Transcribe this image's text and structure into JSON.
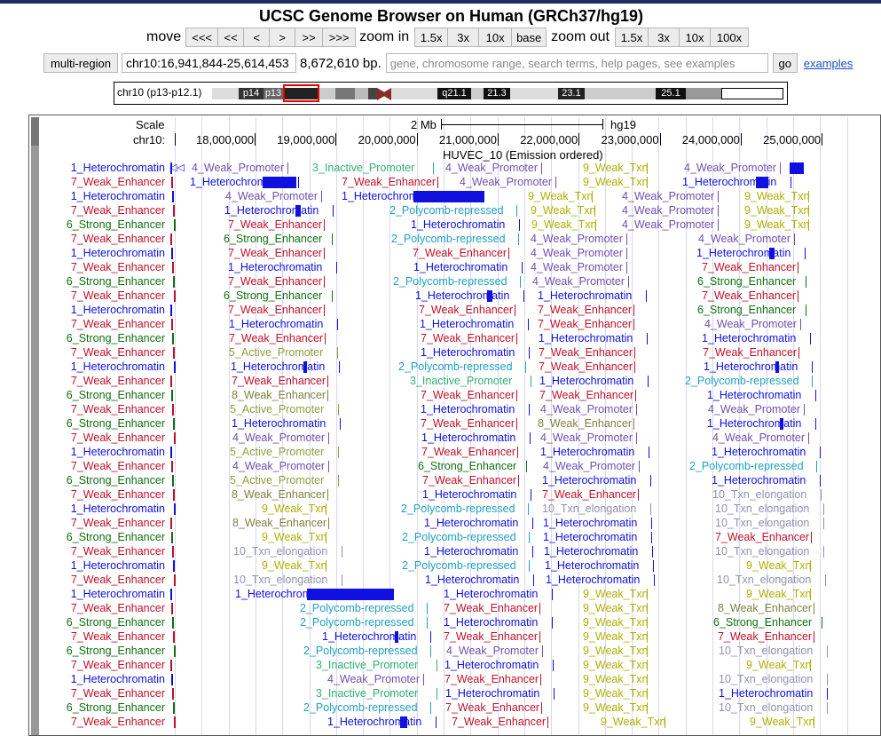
{
  "header": {
    "title": "UCSC Genome Browser on Human (GRCh37/hg19)"
  },
  "nav": {
    "move_label": "move",
    "move_buttons": [
      "<<<",
      "<<",
      "<",
      ">",
      ">>",
      ">>>"
    ],
    "zoom_in_label": "zoom in",
    "zoom_in_buttons": [
      "1.5x",
      "3x",
      "10x",
      "base"
    ],
    "zoom_out_label": "zoom out",
    "zoom_out_buttons": [
      "1.5x",
      "3x",
      "10x",
      "100x"
    ]
  },
  "position": {
    "multi_region": "multi-region",
    "range": "chr10:16,941,844-25,614,453",
    "size": "8,672,610 bp.",
    "search_placeholder": "gene, chromosome range, search terms, help pages, see examples",
    "go": "go",
    "examples": "examples"
  },
  "ideogram": {
    "chrom_label": "chr10 (p13-p12.1)",
    "bands": [
      "p14",
      "p13",
      "q21.1",
      "21.3",
      "23.1",
      "25.1"
    ]
  },
  "tracks": {
    "scale_label": "Scale",
    "scale_bar": "2 Mb",
    "assembly": "hg19",
    "chrom_label": "chr10:",
    "ticks": [
      "18,000,000",
      "19,000,000",
      "20,000,000",
      "21,000,000",
      "22,000,000",
      "23,000,000",
      "24,000,000",
      "25,000,000"
    ],
    "track_title": "HUVEC_10 (Emission ordered)"
  },
  "colors": {
    "Heterochromatin": "#1010e0",
    "Weak_Enhancer": "#c0102a",
    "Strong_Enhancer": "#107010",
    "Weak_Promoter": "#7050b0",
    "Inactive_Promoter": "#30b070",
    "Weak_Txn": "#b0b000",
    "Polycomb": "#20a0c0",
    "Active_Promoter": "#90a040",
    "Txn_elongation": "#9090b0",
    "Weak_Enhancer8": "#808040"
  },
  "rows": [
    {
      "left": "1_Heterochromatin",
      "items": [
        [
          "4_Weak_Promoter",
          215
        ],
        [
          "3_Inactive_Promoter",
          351
        ],
        [
          "4_Weak_Promoter",
          501
        ],
        [
          "9_Weak_Txn",
          656
        ],
        [
          "4_Weak_Promoter",
          770
        ]
      ]
    },
    {
      "left": "7_Weak_Enhancer",
      "items": [
        [
          "1_Heterochromatin",
          213
        ],
        [
          "7_Weak_Enhancer",
          384
        ],
        [
          "4_Weak_Promoter",
          517
        ],
        [
          "9_Weak_Txn",
          656
        ],
        [
          "1_Heterochromatin",
          768
        ]
      ]
    },
    {
      "left": "1_Heterochromatin",
      "items": [
        [
          "4_Weak_Promoter",
          253
        ],
        [
          "1_Heterochromatin",
          384
        ],
        [
          "9_Weak_Txn",
          594
        ],
        [
          "4_Weak_Promoter",
          700
        ],
        [
          "9_Weak_Txn",
          838
        ]
      ]
    },
    {
      "left": "7_Weak_Enhancer",
      "items": [
        [
          "1_Heterochromatin",
          252
        ],
        [
          "2_Polycomb-repressed",
          438
        ],
        [
          "9_Weak_Txn",
          597
        ],
        [
          "4_Weak_Promoter",
          700
        ],
        [
          "9_Weak_Txn",
          838
        ]
      ]
    },
    {
      "left": "6_Strong_Enhancer",
      "items": [
        [
          "7_Weak_Enhancer",
          256
        ],
        [
          "1_Heterochromatin",
          462
        ],
        [
          "9_Weak_Txn",
          598
        ],
        [
          "4_Weak_Promoter",
          700
        ],
        [
          "9_Weak_Txn",
          838
        ]
      ]
    },
    {
      "left": "7_Weak_Enhancer",
      "items": [
        [
          "6_Strong_Enhancer",
          251
        ],
        [
          "2_Polycomb-repressed",
          440
        ],
        [
          "4_Weak_Promoter",
          597
        ],
        [
          "4_Weak_Promoter",
          786
        ]
      ]
    },
    {
      "left": "1_Heterochromatin",
      "items": [
        [
          "7_Weak_Enhancer",
          256
        ],
        [
          "7_Weak_Enhancer",
          464
        ],
        [
          "4_Weak_Promoter",
          597
        ],
        [
          "1_Heterochromatin",
          784
        ]
      ]
    },
    {
      "left": "7_Weak_Enhancer",
      "items": [
        [
          "1_Heterochromatin",
          256
        ],
        [
          "1_Heterochromatin",
          465
        ],
        [
          "4_Weak_Promoter",
          597
        ],
        [
          "7_Weak_Enhancer",
          790
        ]
      ]
    },
    {
      "left": "6_Strong_Enhancer",
      "items": [
        [
          "7_Weak_Enhancer",
          256
        ],
        [
          "2_Polycomb-repressed",
          442
        ],
        [
          "4_Weak_Promoter",
          599
        ],
        [
          "6_Strong_Enhancer",
          785
        ]
      ]
    },
    {
      "left": "7_Weak_Enhancer",
      "items": [
        [
          "6_Strong_Enhancer",
          251
        ],
        [
          "1_Heterochromatin",
          467
        ],
        [
          "1_Heterochromatin",
          605
        ],
        [
          "7_Weak_Enhancer",
          790
        ]
      ]
    },
    {
      "left": "1_Heterochromatin",
      "items": [
        [
          "7_Weak_Enhancer",
          256
        ],
        [
          "7_Weak_Enhancer",
          471
        ],
        [
          "7_Weak_Enhancer",
          605
        ],
        [
          "6_Strong_Enhancer",
          785
        ]
      ]
    },
    {
      "left": "7_Weak_Enhancer",
      "items": [
        [
          "1_Heterochromatin",
          257
        ],
        [
          "1_Heterochromatin",
          472
        ],
        [
          "7_Weak_Enhancer",
          605
        ],
        [
          "4_Weak_Promoter",
          793
        ]
      ]
    },
    {
      "left": "6_Strong_Enhancer",
      "items": [
        [
          "7_Weak_Enhancer",
          257
        ],
        [
          "7_Weak_Enhancer",
          473
        ],
        [
          "1_Heterochromatin",
          606
        ],
        [
          "1_Heterochromatin",
          790
        ]
      ]
    },
    {
      "left": "7_Weak_Enhancer",
      "items": [
        [
          "5_Active_Promoter",
          257
        ],
        [
          "1_Heterochromatin",
          473
        ],
        [
          "7_Weak_Enhancer",
          606
        ],
        [
          "7_Weak_Enhancer",
          791
        ]
      ]
    },
    {
      "left": "1_Heterochromatin",
      "items": [
        [
          "1_Heterochromatin",
          259
        ],
        [
          "2_Polycomb-repressed",
          448
        ],
        [
          "7_Weak_Enhancer",
          606
        ],
        [
          "1_Heterochromatin",
          792
        ]
      ]
    },
    {
      "left": "7_Weak_Enhancer",
      "items": [
        [
          "7_Weak_Enhancer",
          260
        ],
        [
          "3_Inactive_Promoter",
          461
        ],
        [
          "1_Heterochromatin",
          607
        ],
        [
          "2_Polycomb-repressed",
          771
        ]
      ]
    },
    {
      "left": "6_Strong_Enhancer",
      "items": [
        [
          "8_Weak_Enhancer",
          260
        ],
        [
          "7_Weak_Enhancer",
          473
        ],
        [
          "7_Weak_Enhancer",
          607
        ],
        [
          "1_Heterochromatin",
          796
        ]
      ]
    },
    {
      "left": "7_Weak_Enhancer",
      "items": [
        [
          "5_Active_Promoter",
          258
        ],
        [
          "1_Heterochromatin",
          473
        ],
        [
          "4_Weak_Promoter",
          608
        ],
        [
          "4_Weak_Promoter",
          797
        ]
      ]
    },
    {
      "left": "6_Strong_Enhancer",
      "items": [
        [
          "1_Heterochromatin",
          260
        ],
        [
          "7_Weak_Enhancer",
          473
        ],
        [
          "8_Weak_Enhancer",
          605
        ],
        [
          "1_Heterochromatin",
          796
        ]
      ]
    },
    {
      "left": "7_Weak_Enhancer",
      "items": [
        [
          "4_Weak_Promoter",
          261
        ],
        [
          "1_Heterochromatin",
          474
        ],
        [
          "4_Weak_Promoter",
          608
        ],
        [
          "4_Weak_Promoter",
          802
        ]
      ]
    },
    {
      "left": "1_Heterochromatin",
      "items": [
        [
          "5_Active_Promoter",
          258
        ],
        [
          "7_Weak_Enhancer",
          474
        ],
        [
          "1_Heterochromatin",
          608
        ],
        [
          "1_Heterochromatin",
          801
        ]
      ]
    },
    {
      "left": "7_Weak_Enhancer",
      "items": [
        [
          "4_Weak_Promoter",
          261
        ],
        [
          "6_Strong_Enhancer",
          470
        ],
        [
          "4_Weak_Promoter",
          611
        ],
        [
          "2_Polycomb-repressed",
          776
        ]
      ]
    },
    {
      "left": "6_Strong_Enhancer",
      "items": [
        [
          "5_Active_Promoter",
          258
        ],
        [
          "7_Weak_Enhancer",
          475
        ],
        [
          "1_Heterochromatin",
          610
        ],
        [
          "1_Heterochromatin",
          801
        ]
      ]
    },
    {
      "left": "7_Weak_Enhancer",
      "items": [
        [
          "8_Weak_Enhancer",
          260
        ],
        [
          "1_Heterochromatin",
          475
        ],
        [
          "7_Weak_Enhancer",
          610
        ],
        [
          "10_Txn_elongation",
          802
        ]
      ]
    },
    {
      "left": "1_Heterochromatin",
      "items": [
        [
          "9_Weak_Txn",
          294
        ],
        [
          "2_Polycomb-repressed",
          451
        ],
        [
          "10_Txn_elongation",
          610
        ],
        [
          "10_Txn_elongation",
          805
        ]
      ]
    },
    {
      "left": "7_Weak_Enhancer",
      "items": [
        [
          "8_Weak_Enhancer",
          261
        ],
        [
          "1_Heterochromatin",
          477
        ],
        [
          "1_Heterochromatin",
          611
        ],
        [
          "10_Txn_elongation",
          805
        ]
      ]
    },
    {
      "left": "6_Strong_Enhancer",
      "items": [
        [
          "9_Weak_Txn",
          294
        ],
        [
          "2_Polycomb-repressed",
          452
        ],
        [
          "1_Heterochromatin",
          611
        ],
        [
          "7_Weak_Enhancer",
          805
        ]
      ]
    },
    {
      "left": "7_Weak_Enhancer",
      "items": [
        [
          "10_Txn_elongation",
          262
        ],
        [
          "1_Heterochromatin",
          477
        ],
        [
          "1_Heterochromatin",
          612
        ],
        [
          "10_Txn_elongation",
          805
        ]
      ]
    },
    {
      "left": "1_Heterochromatin",
      "items": [
        [
          "9_Weak_Txn",
          294
        ],
        [
          "2_Polycomb-repressed",
          452
        ],
        [
          "1_Heterochromatin",
          613
        ],
        [
          "9_Weak_Txn",
          840
        ]
      ]
    },
    {
      "left": "7_Weak_Enhancer",
      "items": [
        [
          "10_Txn_elongation",
          262
        ],
        [
          "1_Heterochromatin",
          478
        ],
        [
          "1_Heterochromatin",
          614
        ],
        [
          "10_Txn_elongation",
          807
        ]
      ]
    },
    {
      "left": "1_Heterochromatin",
      "items": [
        [
          "1_Heterochromatin",
          264
        ],
        [
          "1_Heterochromatin",
          499
        ],
        [
          "9_Weak_Txn",
          656
        ],
        [
          "9_Weak_Txn",
          840
        ]
      ]
    },
    {
      "left": "7_Weak_Enhancer",
      "items": [
        [
          "2_Polycomb-repressed",
          337
        ],
        [
          "7_Weak_Enhancer",
          499
        ],
        [
          "9_Weak_Txn",
          656
        ],
        [
          "8_Weak_Enhancer",
          808
        ]
      ]
    },
    {
      "left": "6_Strong_Enhancer",
      "items": [
        [
          "2_Polycomb-repressed",
          337
        ],
        [
          "1_Heterochromatin",
          499
        ],
        [
          "9_Weak_Txn",
          656
        ],
        [
          "6_Strong_Enhancer",
          803
        ]
      ]
    },
    {
      "left": "7_Weak_Enhancer",
      "items": [
        [
          "1_Heterochromatin",
          362
        ],
        [
          "7_Weak_Enhancer",
          499
        ],
        [
          "9_Weak_Txn",
          656
        ],
        [
          "7_Weak_Enhancer",
          808
        ]
      ]
    },
    {
      "left": "6_Strong_Enhancer",
      "items": [
        [
          "2_Polycomb-repressed",
          341
        ],
        [
          "4_Weak_Promoter",
          502
        ],
        [
          "9_Weak_Txn",
          656
        ],
        [
          "10_Txn_elongation",
          809
        ]
      ]
    },
    {
      "left": "7_Weak_Enhancer",
      "items": [
        [
          "3_Inactive_Promoter",
          355
        ],
        [
          "1_Heterochromatin",
          500
        ],
        [
          "9_Weak_Txn",
          656
        ],
        [
          "9_Weak_Txn",
          840
        ]
      ]
    },
    {
      "left": "1_Heterochromatin",
      "items": [
        [
          "4_Weak_Promoter",
          368
        ],
        [
          "7_Weak_Enhancer",
          500
        ],
        [
          "9_Weak_Txn",
          656
        ],
        [
          "10_Txn_elongation",
          809
        ]
      ]
    },
    {
      "left": "7_Weak_Enhancer",
      "items": [
        [
          "3_Inactive_Promoter",
          355
        ],
        [
          "1_Heterochromatin",
          501
        ],
        [
          "9_Weak_Txn",
          656
        ],
        [
          "1_Heterochromatin",
          809
        ]
      ]
    },
    {
      "left": "6_Strong_Enhancer",
      "items": [
        [
          "2_Polycomb-repressed",
          341
        ],
        [
          "7_Weak_Enhancer",
          501
        ],
        [
          "9_Weak_Txn",
          656
        ],
        [
          "10_Txn_elongation",
          809
        ]
      ]
    },
    {
      "left": "7_Weak_Enhancer",
      "items": [
        [
          "1_Heterochromatin",
          368
        ],
        [
          "7_Weak_Enhancer",
          508
        ],
        [
          "9_Weak_Txn",
          676
        ],
        [
          "9_Weak_Txn",
          844
        ]
      ]
    }
  ]
}
